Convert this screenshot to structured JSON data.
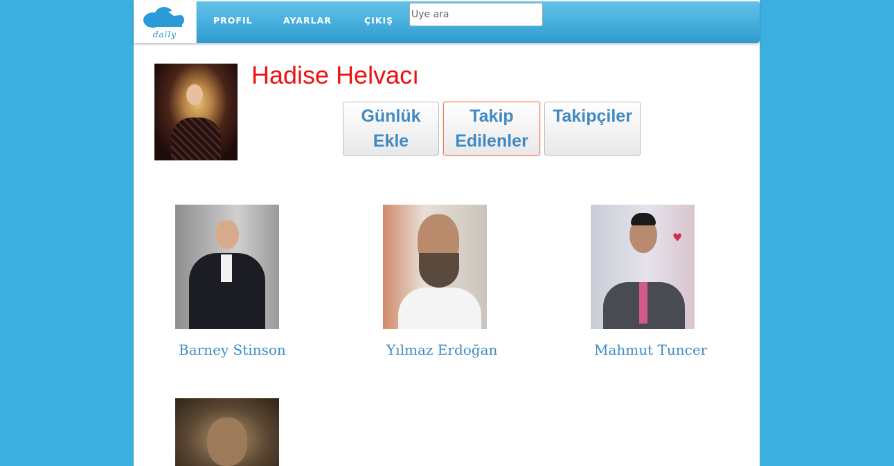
{
  "navbar": {
    "logo_text": "daily",
    "links": [
      "PROFIL",
      "AYARLAR",
      "ÇIKIŞ"
    ],
    "search_placeholder": "Üye ara"
  },
  "profile": {
    "name": "Hadise Helvacı"
  },
  "buttons": {
    "add_diary_line1": "Günlük",
    "add_diary_line2": "Ekle",
    "following_line1": "Takip",
    "following_line2": "Edilenler",
    "followers": "Takipçiler"
  },
  "following": [
    {
      "name": "Barney Stinson"
    },
    {
      "name": "Yılmaz Erdoğan"
    },
    {
      "name": "Mahmut Tuncer"
    },
    {
      "name": ""
    }
  ],
  "colors": {
    "background": "#3cafe0",
    "navbar": "#3aa6d8",
    "profile_name": "#ee1111",
    "link": "#3a8bc4",
    "active_button_border": "#f07d55"
  }
}
